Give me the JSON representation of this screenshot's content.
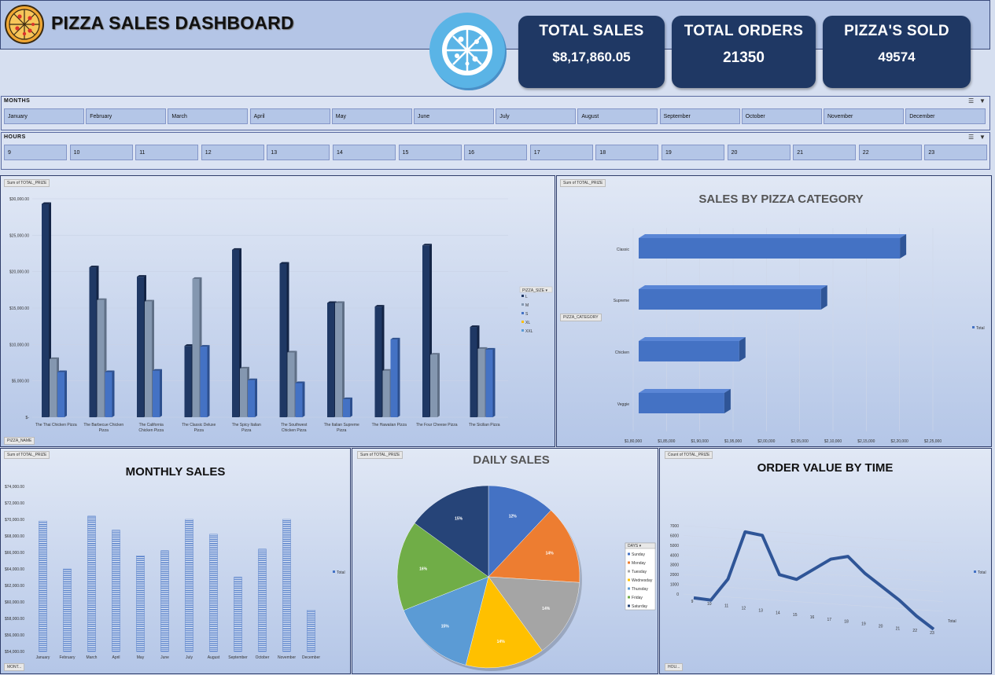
{
  "title": "PIZZA SALES DASHBOARD",
  "kpis": [
    {
      "label": "TOTAL SALES",
      "value": "$8,17,860.05"
    },
    {
      "label": "TOTAL ORDERS",
      "value": "21350"
    },
    {
      "label": "PIZZA'S SOLD",
      "value": "49574"
    }
  ],
  "slicers": {
    "months_title": "MONTHS",
    "months": [
      "January",
      "February",
      "March",
      "April",
      "May",
      "June",
      "July",
      "August",
      "September",
      "October",
      "November",
      "December"
    ],
    "hours_title": "HOURS",
    "hours": [
      "9",
      "10",
      "11",
      "12",
      "13",
      "14",
      "15",
      "16",
      "17",
      "18",
      "19",
      "20",
      "21",
      "22",
      "23"
    ]
  },
  "colors": {
    "dark_navy": "#1f3864",
    "blue": "#4472c4",
    "gray_blue": "#8497b0"
  },
  "icons": [
    "pizza-icon",
    "pizza-logo-icon",
    "multi-select-icon",
    "clear-filter-icon"
  ],
  "chart_data": [
    {
      "type": "bar",
      "field_button": "Sum of TOTAL_PRIZE",
      "axis_button": "PIZZA_NAME",
      "legend_title": "PIZZA_SIZE",
      "legend_position": "right",
      "categories": [
        "The Thai Chicken Pizza",
        "The Barbecue Chicken Pizza",
        "The California Chicken Pizza",
        "The Classic Deluxe Pizza",
        "The Spicy Italian Pizza",
        "The Southwest Chicken Pizza",
        "The Italian Supreme Pizza",
        "The Hawaiian Pizza",
        "The Four Cheese Pizza",
        "The Sicilian Pizza"
      ],
      "series": [
        {
          "name": "L",
          "values": [
            29300,
            20600,
            19300,
            9800,
            23000,
            21100,
            15700,
            15200,
            23600,
            12400
          ]
        },
        {
          "name": "M",
          "values": [
            8000,
            16100,
            15900,
            19000,
            6700,
            8900,
            15700,
            6400,
            8600,
            9400
          ]
        },
        {
          "name": "S",
          "values": [
            6200,
            6200,
            6400,
            9700,
            5100,
            4700,
            2500,
            10700,
            0,
            9300
          ]
        },
        {
          "name": "XL",
          "values": [
            0,
            0,
            0,
            0,
            0,
            0,
            0,
            0,
            0,
            0
          ]
        },
        {
          "name": "XXL",
          "values": [
            0,
            0,
            0,
            0,
            0,
            0,
            0,
            0,
            0,
            0
          ]
        }
      ],
      "yticks": [
        "$-",
        "$5,000.00",
        "$10,000.00",
        "$15,000.00",
        "$20,000.00",
        "$25,000.00",
        "$30,000.00"
      ],
      "ylim": [
        0,
        30000
      ],
      "grid": true
    },
    {
      "type": "bar",
      "orientation": "horizontal",
      "title": "SALES BY PIZZA CATEGORY",
      "field_button": "Sum of TOTAL_PRIZE",
      "axis_button": "PIZZA_CATEGORY",
      "categories": [
        "Classic",
        "Supreme",
        "Chicken",
        "Veggie"
      ],
      "series": [
        {
          "name": "Total",
          "values": [
            220053,
            208197,
            195920,
            193690
          ]
        }
      ],
      "xticks": [
        "$1,80,000",
        "$1,85,000",
        "$1,90,000",
        "$1,95,000",
        "$2,00,000",
        "$2,05,000",
        "$2,10,000",
        "$2,15,000",
        "$2,20,000",
        "$2,25,000"
      ],
      "xlim": [
        180000,
        225000
      ],
      "legend_position": "right",
      "grid": true
    },
    {
      "type": "bar",
      "title": "MONTHLY SALES",
      "field_button": "Sum of TOTAL_PRIZE",
      "axis_button": "MONT...",
      "categories": [
        "January",
        "February",
        "March",
        "April",
        "May",
        "June",
        "July",
        "August",
        "September",
        "October",
        "November",
        "December"
      ],
      "series": [
        {
          "name": "Total",
          "values": [
            69800,
            64000,
            70400,
            68700,
            65600,
            66200,
            70000,
            68200,
            63000,
            66400,
            70000,
            59000
          ]
        }
      ],
      "yticks": [
        "$54,000.00",
        "$56,000.00",
        "$58,000.00",
        "$60,000.00",
        "$62,000.00",
        "$64,000.00",
        "$66,000.00",
        "$68,000.00",
        "$70,000.00",
        "$72,000.00",
        "$74,000.00"
      ],
      "ylim": [
        54000,
        74000
      ],
      "legend_position": "right",
      "grid": true
    },
    {
      "type": "pie",
      "title": "DAILY SALES",
      "field_button": "Sum of TOTAL_PRIZE",
      "legend_title": "DAYS",
      "labels": [
        "Sunday",
        "Monday",
        "Tuesday",
        "Wednesday",
        "Thursday",
        "Friday",
        "Saturday"
      ],
      "values": [
        12,
        14,
        14,
        14,
        15,
        16,
        15
      ],
      "value_labels": [
        "12%",
        "14%",
        "14%",
        "14%",
        "15%",
        "16%",
        "15%"
      ],
      "colors": [
        "#4472c4",
        "#ed7d31",
        "#a5a5a5",
        "#ffc000",
        "#5b9bd5",
        "#70ad47",
        "#264478"
      ],
      "legend_position": "right"
    },
    {
      "type": "line",
      "title": "ORDER VALUE BY TIME",
      "field_button": "Count of TOTAL_PRIZE",
      "axis_button": "HOU...",
      "x": [
        "9",
        "10",
        "11",
        "12",
        "13",
        "14",
        "15",
        "16",
        "17",
        "18",
        "19",
        "20",
        "21",
        "22",
        "23"
      ],
      "series": [
        {
          "name": "Total",
          "values": [
            10,
            10,
            1900,
            5900,
            5800,
            2800,
            2600,
            3600,
            4600,
            5000,
            3800,
            2900,
            2000,
            900,
            20
          ]
        }
      ],
      "yticks": [
        "0",
        "1000",
        "2000",
        "3000",
        "4000",
        "5000",
        "6000",
        "7000"
      ],
      "ylim": [
        0,
        7000
      ],
      "legend_position": "right",
      "grid": true
    }
  ]
}
